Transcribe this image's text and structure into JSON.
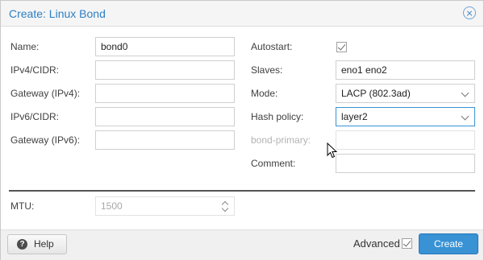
{
  "window": {
    "title": "Create: Linux Bond",
    "close_icon": "close-circle-icon"
  },
  "left_column": {
    "name": {
      "label": "Name:",
      "value": "bond0"
    },
    "ipv4_cidr": {
      "label": "IPv4/CIDR:",
      "value": ""
    },
    "gateway_ipv4": {
      "label": "Gateway (IPv4):",
      "value": ""
    },
    "ipv6_cidr": {
      "label": "IPv6/CIDR:",
      "value": ""
    },
    "gateway_ipv6": {
      "label": "Gateway (IPv6):",
      "value": ""
    }
  },
  "right_column": {
    "autostart": {
      "label": "Autostart:",
      "checked": true
    },
    "slaves": {
      "label": "Slaves:",
      "value": "eno1 eno2"
    },
    "mode": {
      "label": "Mode:",
      "value": "LACP (802.3ad)"
    },
    "hash_policy": {
      "label": "Hash policy:",
      "value": "layer2"
    },
    "bond_primary": {
      "label": "bond-primary:",
      "value": "",
      "disabled": true
    },
    "comment": {
      "label": "Comment:",
      "value": ""
    }
  },
  "mtu": {
    "label": "MTU:",
    "placeholder": "1500",
    "disabled": true
  },
  "footer": {
    "help_label": "Help",
    "help_icon": "question-circle-icon",
    "advanced_label": "Advanced",
    "advanced_checked": true,
    "create_label": "Create"
  },
  "colors": {
    "title": "#2c7fc4",
    "primary_button": "#3892d4",
    "focus_border": "#3892d4",
    "disabled_text": "#b3b3b3"
  }
}
